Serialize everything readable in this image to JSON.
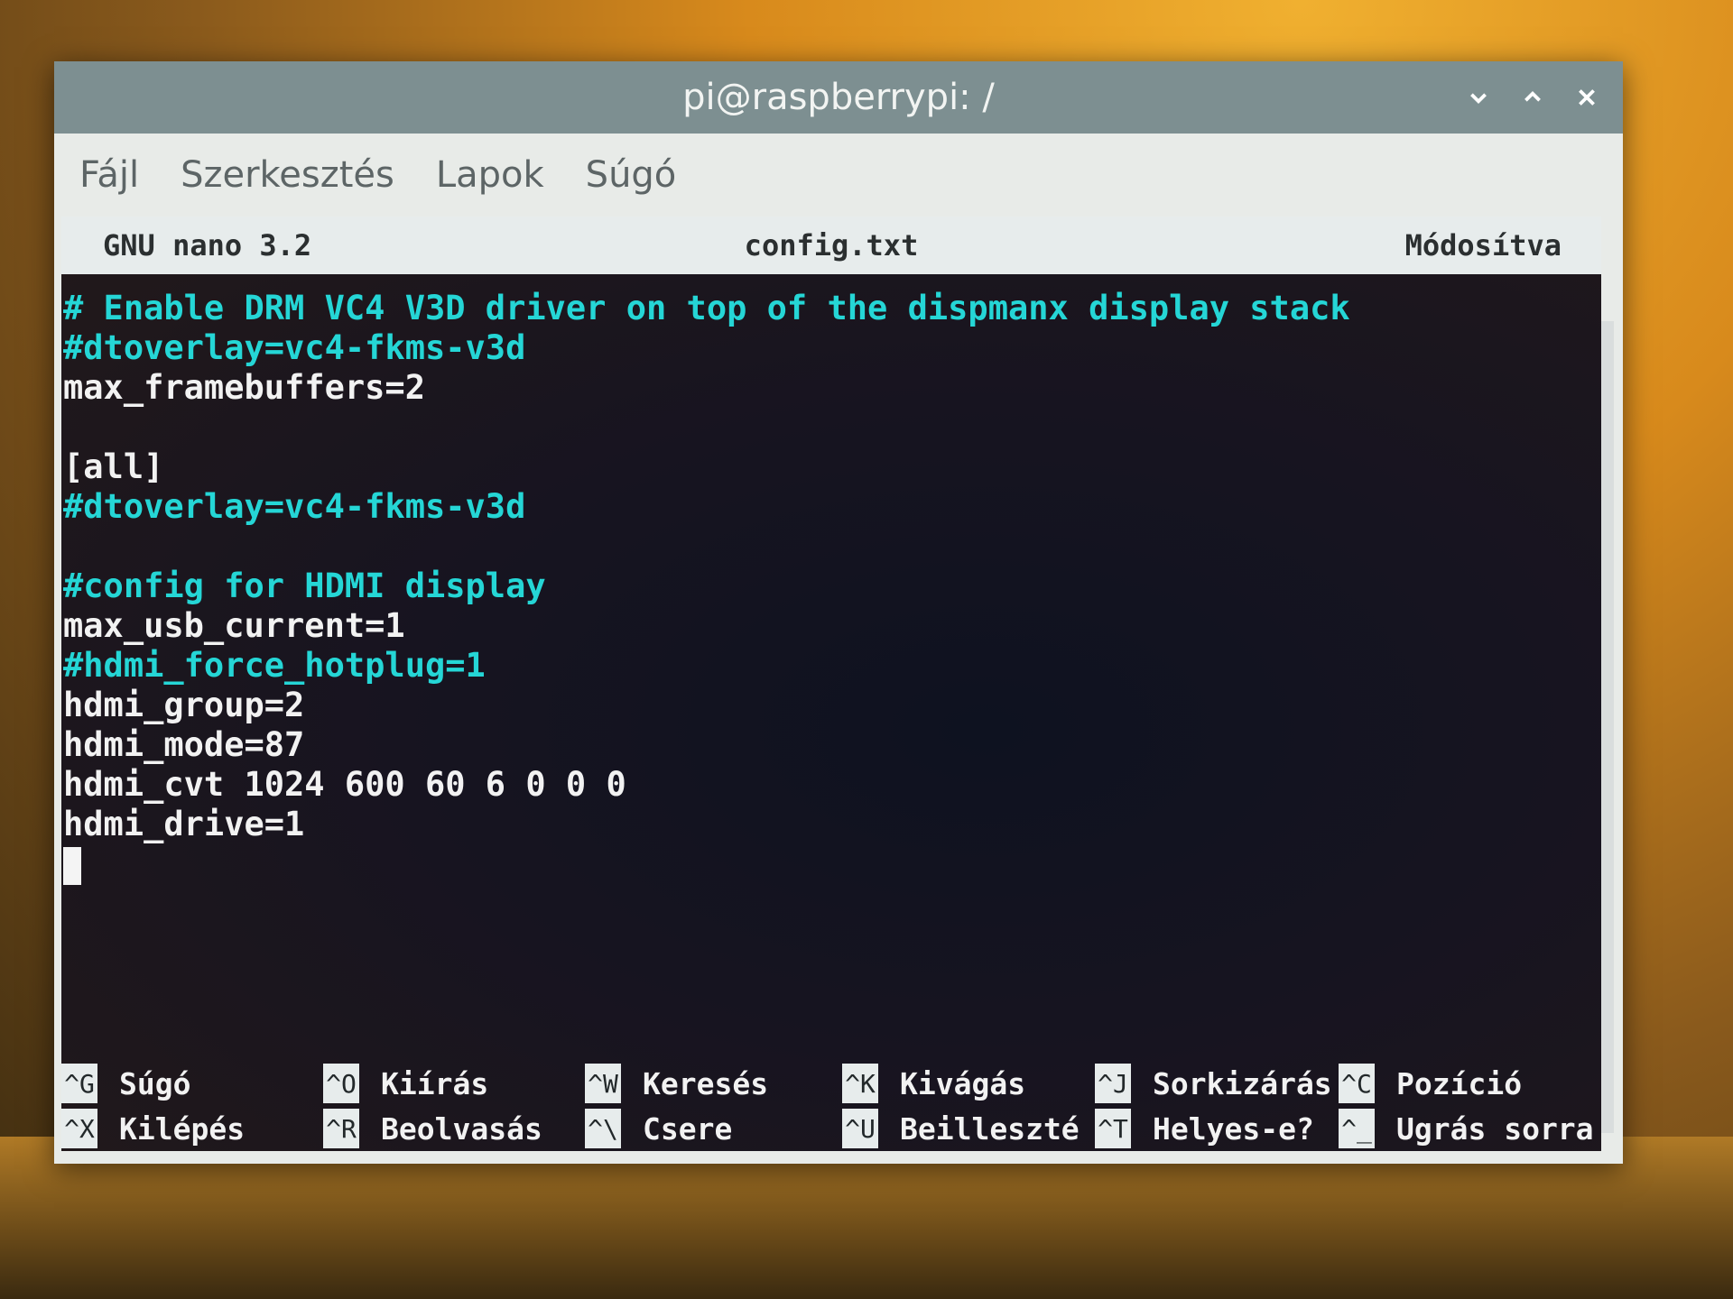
{
  "window": {
    "title": "pi@raspberrypi: /",
    "buttons": {
      "minimize_icon": "chevron-down-icon",
      "maximize_icon": "chevron-up-icon",
      "close_icon": "close-icon"
    }
  },
  "menubar": {
    "items": [
      {
        "label": "Fájl"
      },
      {
        "label": "Szerkesztés"
      },
      {
        "label": "Lapok"
      },
      {
        "label": "Súgó"
      }
    ]
  },
  "nano": {
    "version": "GNU nano 3.2",
    "filename": "config.txt",
    "status": "Módosítva"
  },
  "editor": {
    "lines": [
      {
        "text": "# Enable DRM VC4 V3D driver on top of the dispmanx display stack",
        "kind": "comment"
      },
      {
        "text": "#dtoverlay=vc4-fkms-v3d",
        "kind": "comment"
      },
      {
        "text": "max_framebuffers=2",
        "kind": "plain"
      },
      {
        "text": "",
        "kind": "plain"
      },
      {
        "text": "[all]",
        "kind": "plain"
      },
      {
        "text": "#dtoverlay=vc4-fkms-v3d",
        "kind": "comment"
      },
      {
        "text": "",
        "kind": "plain"
      },
      {
        "text": "#config for HDMI display",
        "kind": "comment"
      },
      {
        "text": "max_usb_current=1",
        "kind": "plain"
      },
      {
        "text": "#hdmi_force_hotplug=1",
        "kind": "comment"
      },
      {
        "text": "hdmi_group=2",
        "kind": "plain"
      },
      {
        "text": "hdmi_mode=87",
        "kind": "plain"
      },
      {
        "text": "hdmi_cvt 1024 600 60 6 0 0 0",
        "kind": "plain"
      },
      {
        "text": "hdmi_drive=1",
        "kind": "plain"
      }
    ]
  },
  "shortcuts": {
    "row1": [
      {
        "key": "^G",
        "label": "Súgó"
      },
      {
        "key": "^O",
        "label": "Kiírás"
      },
      {
        "key": "^W",
        "label": "Keresés"
      },
      {
        "key": "^K",
        "label": "Kivágás"
      },
      {
        "key": "^J",
        "label": "Sorkizárás"
      },
      {
        "key": "^C",
        "label": "Pozíció"
      }
    ],
    "row2": [
      {
        "key": "^X",
        "label": "Kilépés"
      },
      {
        "key": "^R",
        "label": "Beolvasás"
      },
      {
        "key": "^\\",
        "label": "Csere"
      },
      {
        "key": "^U",
        "label": "Beilleszté"
      },
      {
        "key": "^T",
        "label": "Helyes-e?"
      },
      {
        "key": "^_",
        "label": "Ugrás sorra"
      }
    ]
  }
}
